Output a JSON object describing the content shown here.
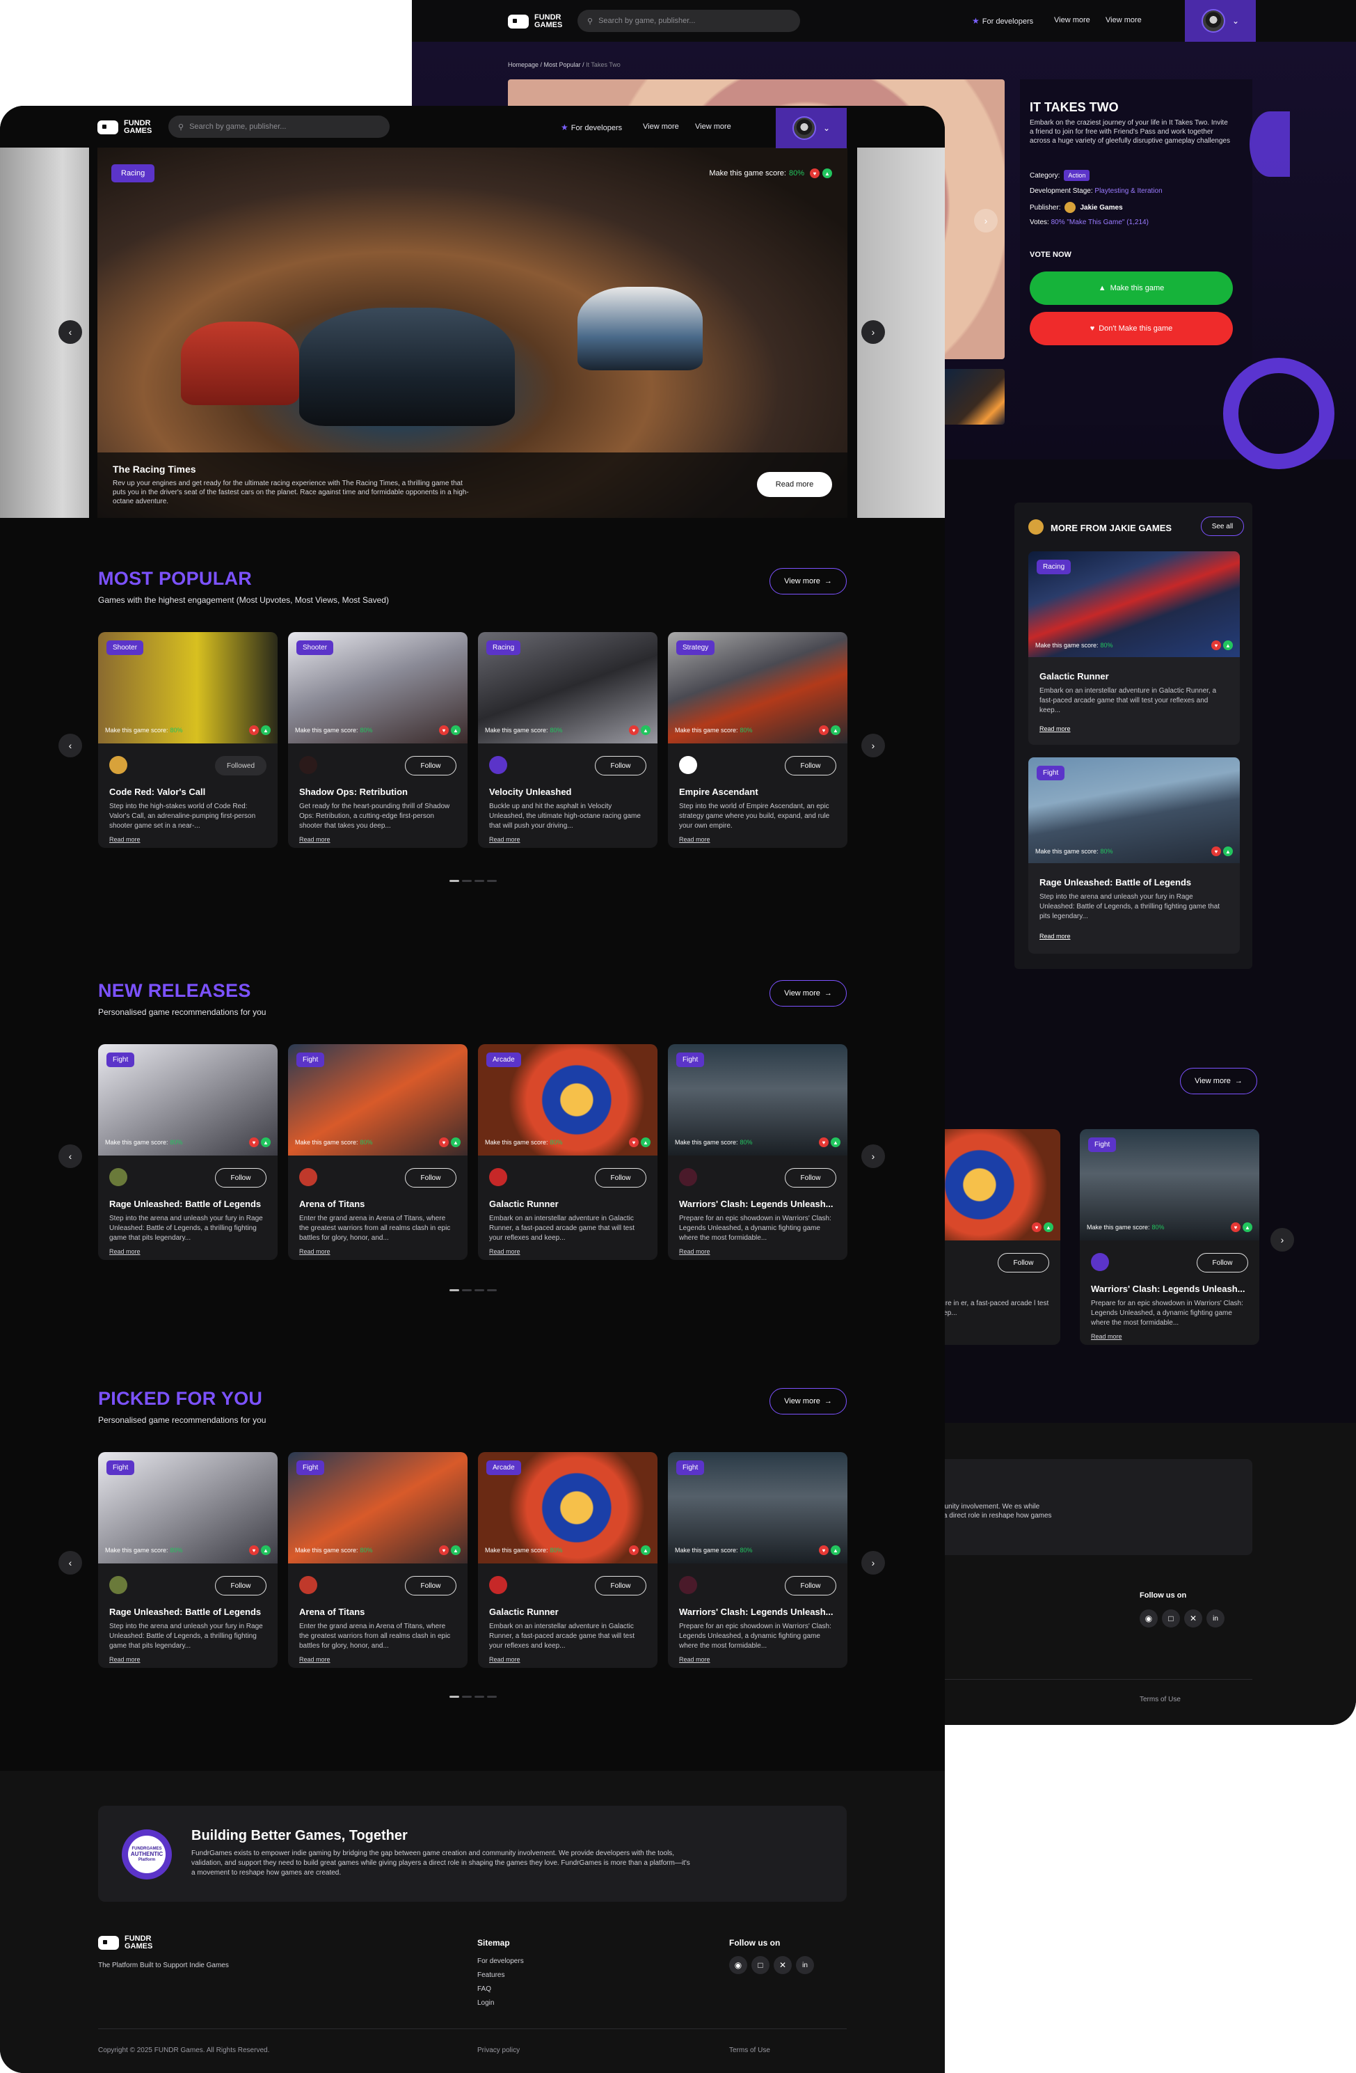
{
  "header": {
    "logo_line1": "FUNDR",
    "logo_line2": "GAMES",
    "search_placeholder": "Search by game, publisher...",
    "nav": [
      "For developers",
      "View more",
      "View more"
    ]
  },
  "detail": {
    "breadcrumb": [
      "Homepage",
      "Most Popular",
      "It Takes Two"
    ],
    "title": "IT TAKES TWO",
    "description": "Embark on the craziest journey of your life in It Takes Two. Invite a friend to join for free with Friend's Pass and work together across a huge variety of gleefully disruptive gameplay challenges",
    "category_label": "Category:",
    "category": "Action",
    "stage_label": "Development Stage:",
    "stage": "Playtesting & Iteration",
    "publisher_label": "Publisher:",
    "publisher": "Jakie Games",
    "votes_label": "Votes:",
    "votes": "80% \"Make This Game\" (1,214)",
    "vote_now": "VOTE NOW",
    "make_button": "Make this game",
    "dont_button": "Don't Make this game",
    "colors": {
      "make": "#16b33a",
      "dont": "#ef2b2b",
      "accent": "#7c52ff"
    }
  },
  "more_from": {
    "title": "MORE FROM JAKIE GAMES",
    "see_all": "See all",
    "cards": [
      {
        "tag": "Racing",
        "title": "Galactic Runner",
        "desc": "Embark on an interstellar adventure in Galactic Runner, a fast-paced arcade game that will test your reflexes and keep..."
      },
      {
        "tag": "Fight",
        "title": "Rage Unleashed: Battle of Legends",
        "desc": "Step into the arena and unleash your fury in Rage Unleashed: Battle of Legends, a thrilling fighting game that pits legendary..."
      }
    ]
  },
  "back_row": {
    "view_more": "View more",
    "card_a": {
      "title": "unner",
      "desc": "n interstellar adventure in er, a fast-paced arcade l test your reflexes and keep..."
    },
    "card_b": {
      "tag": "Fight",
      "title": "Warriors' Clash: Legends Unleash...",
      "desc": "Prepare for an epic showdown in Warriors' Clash: Legends Unleashed, a dynamic fighting game where the most formidable..."
    }
  },
  "back_footer": {
    "about_partial": "tion and community involvement. We es while giving players a direct role in reshape how games are created.",
    "follow_us": "Follow us on",
    "terms": "Terms of Use"
  },
  "hero": {
    "tag": "Racing",
    "score_label": "Make this game score:",
    "score": "80%",
    "title": "The Racing Times",
    "desc": "Rev up your engines and get ready for the ultimate racing experience with The Racing Times, a thrilling game that puts you in the driver's seat of the fastest cars on the planet. Race against time and formidable opponents in a high-octane adventure.",
    "read_more": "Read more"
  },
  "common": {
    "score_label": "Make this game score:",
    "score": "80%",
    "follow": "Follow",
    "followed": "Followed",
    "read_more": "Read more",
    "view_more": "View more"
  },
  "sections": {
    "popular": {
      "title": "MOST POPULAR",
      "subtitle": "Games with the highest engagement (Most Upvotes, Most Views, Most Saved)",
      "cards": [
        {
          "tag": "Shooter",
          "title": "Code Red: Valor's Call",
          "desc": "Step into the high-stakes world of Code Red: Valor's Call, an adrenaline-pumping first-person shooter game set in a near-...",
          "follow": "Followed"
        },
        {
          "tag": "Shooter",
          "title": "Shadow Ops: Retribution",
          "desc": "Get ready for the heart-pounding thrill of Shadow Ops: Retribution, a cutting-edge first-person shooter that takes you deep...",
          "follow": "Follow"
        },
        {
          "tag": "Racing",
          "title": "Velocity Unleashed",
          "desc": "Buckle up and hit the asphalt in Velocity Unleashed, the ultimate high-octane racing game that will push your driving...",
          "follow": "Follow"
        },
        {
          "tag": "Strategy",
          "title": "Empire Ascendant",
          "desc": "Step into the world of Empire Ascendant, an epic strategy game where you build, expand, and rule your own empire.",
          "follow": "Follow"
        }
      ]
    },
    "releases": {
      "title": "NEW RELEASES",
      "subtitle": "Personalised game recommendations for you",
      "cards": [
        {
          "tag": "Fight",
          "title": "Rage Unleashed: Battle of Legends",
          "desc": "Step into the arena and unleash your fury in Rage Unleashed: Battle of Legends, a thrilling fighting game that pits legendary...",
          "follow": "Follow"
        },
        {
          "tag": "Fight",
          "title": "Arena of Titans",
          "desc": "Enter the grand arena in Arena of Titans, where the greatest warriors from all realms clash in epic battles for glory, honor, and...",
          "follow": "Follow"
        },
        {
          "tag": "Arcade",
          "title": "Galactic Runner",
          "desc": "Embark on an interstellar adventure in Galactic Runner, a fast-paced arcade game that will test your reflexes and keep...",
          "follow": "Follow"
        },
        {
          "tag": "Fight",
          "title": "Warriors' Clash: Legends Unleash...",
          "desc": "Prepare for an epic showdown in Warriors' Clash: Legends Unleashed, a dynamic fighting game where the most formidable...",
          "follow": "Follow"
        }
      ]
    },
    "picked": {
      "title": "PICKED FOR YOU",
      "subtitle": "Personalised game recommendations for you",
      "cards": [
        {
          "tag": "Fight",
          "title": "Rage Unleashed: Battle of Legends",
          "desc": "Step into the arena and unleash your fury in Rage Unleashed: Battle of Legends, a thrilling fighting game that pits legendary...",
          "follow": "Follow"
        },
        {
          "tag": "Fight",
          "title": "Arena of Titans",
          "desc": "Enter the grand arena in Arena of Titans, where the greatest warriors from all realms clash in epic battles for glory, honor, and...",
          "follow": "Follow"
        },
        {
          "tag": "Arcade",
          "title": "Galactic Runner",
          "desc": "Embark on an interstellar adventure in Galactic Runner, a fast-paced arcade game that will test your reflexes and keep...",
          "follow": "Follow"
        },
        {
          "tag": "Fight",
          "title": "Warriors' Clash: Legends Unleash...",
          "desc": "Prepare for an epic showdown in Warriors' Clash: Legends Unleashed, a dynamic fighting game where the most formidable...",
          "follow": "Follow"
        }
      ]
    }
  },
  "about": {
    "badge_top": "FUNDRGAMES",
    "badge_main": "AUTHENTIC",
    "badge_sub": "Platform",
    "title": "Building Better Games, Together",
    "text": "FundrGames exists to empower indie gaming by bridging the gap between game creation and community involvement. We provide developers with the tools, validation, and support they need to build great games while giving players a direct role in shaping the games they love. FundrGames is more than a platform—it's a movement to reshape how games are created."
  },
  "footer": {
    "tagline": "The Platform Built to Support Indie Games",
    "sitemap_title": "Sitemap",
    "sitemap": [
      "For developers",
      "Features",
      "FAQ",
      "Login"
    ],
    "follow_title": "Follow us on",
    "social_icons": [
      "discord-icon",
      "instagram-icon",
      "x-icon",
      "linkedin-icon"
    ],
    "copyright": "Copyright © 2025 FUNDR Games. All Rights Reserved.",
    "privacy": "Privacy policy",
    "terms": "Terms of Use"
  }
}
